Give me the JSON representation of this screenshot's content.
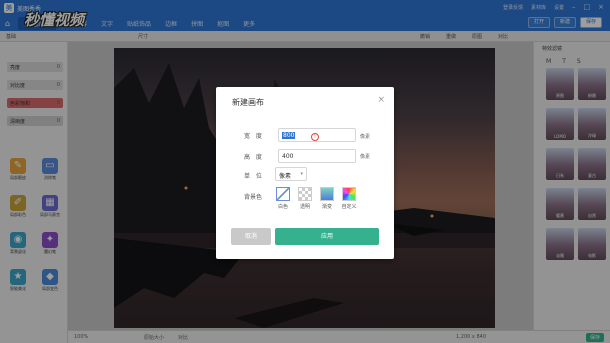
{
  "app": {
    "name": "美图秀秀",
    "logo": "美"
  },
  "watermark": "秒懂视频",
  "nav": [
    "美化图片",
    "人像美容",
    "文字",
    "贴纸饰品",
    "边框",
    "拼图",
    "抠图",
    "更多"
  ],
  "top_right": [
    "登录反馈",
    "素材库",
    "设置"
  ],
  "toolbar_buttons": {
    "open": "打开",
    "new": "新建",
    "save": "保存"
  },
  "toolbar2": {
    "left": "基础",
    "mid": "尺寸",
    "r1": "撤销",
    "r2": "重做",
    "r3": "原图",
    "r4": "对比"
  },
  "left_panel": {
    "layers": [
      {
        "label": "亮度",
        "value": "0",
        "color": "#d8d8d8"
      },
      {
        "label": "对比度",
        "value": "0",
        "color": "#d8d8d8"
      },
      {
        "label": "色彩饱和",
        "value": "0",
        "color": "#d96b6b"
      },
      {
        "label": "清晰度",
        "value": "0",
        "color": "#cfcfcf"
      }
    ],
    "tools": [
      {
        "label": "局部磨皮",
        "icon": "brush-icon",
        "color": "#e5a33c"
      },
      {
        "label": "消除笔",
        "icon": "eraser-icon",
        "color": "#5a8ad8"
      },
      {
        "label": "局部彩色",
        "icon": "pen-icon",
        "color": "#c9a43b"
      },
      {
        "label": "局部马赛克",
        "icon": "mosaic-icon",
        "color": "#6b6bd0"
      },
      {
        "label": "背景虚化",
        "icon": "blur-icon",
        "color": "#3aa6c8"
      },
      {
        "label": "魔幻笔",
        "icon": "magic-icon",
        "color": "#8d4ec9"
      },
      {
        "label": "智能美化",
        "icon": "star-icon",
        "color": "#3aa6c8"
      },
      {
        "label": "局部变色",
        "icon": "drop-icon",
        "color": "#4a8ad8"
      }
    ]
  },
  "right_panel": {
    "header": "特效滤镜",
    "tabs": [
      "M",
      "T",
      "S"
    ],
    "thumbs": [
      "原图",
      "粉嫩",
      "LOMO",
      "冷绿",
      "日系",
      "复古",
      "暖黄",
      "自然",
      "淡雅",
      "电影"
    ]
  },
  "status": {
    "zoom": "100%",
    "size": "1,200 x 840",
    "save": "保存",
    "fit": "原始大小",
    "compare": "对比"
  },
  "dialog": {
    "title": "新建画布",
    "width_label": "宽 度",
    "width_value": "800",
    "height_label": "高 度",
    "height_value": "400",
    "unit_px_label": "像素",
    "unit_label": "单 位",
    "unit_value": "像素",
    "bg_label": "背景色",
    "bg_options": [
      "白色",
      "透明",
      "渐变",
      "自定义"
    ],
    "cancel": "取消",
    "apply": "应用",
    "close": "×"
  }
}
